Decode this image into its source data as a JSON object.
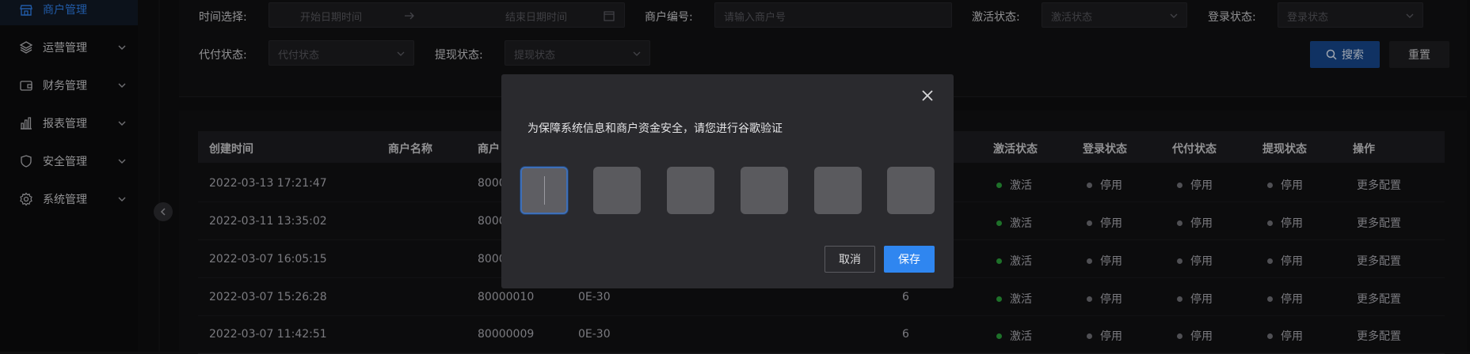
{
  "sidebar": {
    "items": [
      {
        "label": "商户管理",
        "icon": "store-icon"
      },
      {
        "label": "运营管理",
        "icon": "layers-icon"
      },
      {
        "label": "财务管理",
        "icon": "wallet-icon"
      },
      {
        "label": "报表管理",
        "icon": "bar-chart-icon"
      },
      {
        "label": "安全管理",
        "icon": "shield-icon"
      },
      {
        "label": "系统管理",
        "icon": "gear-icon"
      }
    ]
  },
  "filters": {
    "time_label": "时间选择:",
    "start_placeholder": "开始日期时间",
    "end_placeholder": "结束日期时间",
    "merchant_no_label": "商户编号:",
    "merchant_no_placeholder": "请输入商户号",
    "activation_label": "激活状态:",
    "activation_placeholder": "激活状态",
    "login_label": "登录状态:",
    "login_placeholder": "登录状态",
    "payout_label": "代付状态:",
    "payout_placeholder": "代付状态",
    "withdraw_label": "提现状态:",
    "withdraw_placeholder": "提现状态",
    "search_label": "搜索",
    "reset_label": "重置"
  },
  "table": {
    "headers": {
      "created": "创建时间",
      "name": "商户名称",
      "no": "商户",
      "activation": "激活状态",
      "login": "登录状态",
      "payout": "代付状态",
      "withdraw": "提现状态",
      "action": "操作"
    },
    "rows": [
      {
        "created": "2022-03-13 17:21:47",
        "no": "8000",
        "col4": "",
        "col5": "",
        "activation": "激活",
        "login": "停用",
        "payout": "停用",
        "withdraw": "停用",
        "action": "更多配置"
      },
      {
        "created": "2022-03-11 13:35:02",
        "no": "8000",
        "col4": "",
        "col5": "",
        "activation": "激活",
        "login": "停用",
        "payout": "停用",
        "withdraw": "停用",
        "action": "更多配置"
      },
      {
        "created": "2022-03-07 16:05:15",
        "no": "8000",
        "col4": "",
        "col5": "",
        "activation": "激活",
        "login": "停用",
        "payout": "停用",
        "withdraw": "停用",
        "action": "更多配置"
      },
      {
        "created": "2022-03-07 15:26:28",
        "no": "80000010",
        "col4": "0E-30",
        "col5": "6",
        "activation": "激活",
        "login": "停用",
        "payout": "停用",
        "withdraw": "停用",
        "action": "更多配置"
      },
      {
        "created": "2022-03-07 11:42:51",
        "no": "80000009",
        "col4": "0E-30",
        "col5": "6",
        "activation": "激活",
        "login": "停用",
        "payout": "停用",
        "withdraw": "停用",
        "action": "更多配置"
      }
    ]
  },
  "modal": {
    "message": "为保障系统信息和商户资金安全，请您进行谷歌验证",
    "cancel_label": "取消",
    "save_label": "保存"
  },
  "colors": {
    "accent": "#2f86f0",
    "active_status": "#2a9d3a",
    "inactive_status": "#6f6f75"
  }
}
